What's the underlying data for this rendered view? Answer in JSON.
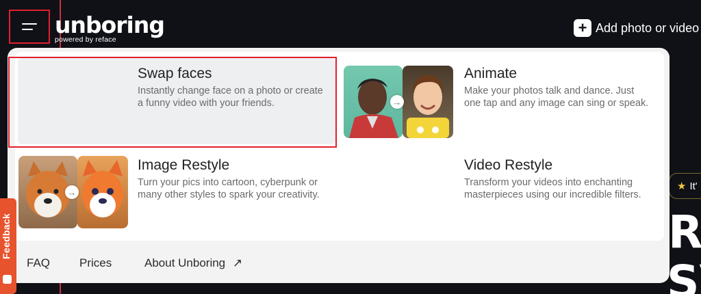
{
  "header": {
    "logo_text": "unboring",
    "logo_subtitle": "powered by reface",
    "add_button_label": "Add photo or video",
    "menu_icon": "hamburger-icon"
  },
  "menu": {
    "cards": [
      {
        "title": "Swap faces",
        "description": "Instantly change face on a photo or create a funny video with your friends.",
        "selected": true
      },
      {
        "title": "Animate",
        "description": "Make your photos talk and dance. Just one tap and any image can sing or speak."
      },
      {
        "title": "Image Restyle",
        "description": "Turn your pics into cartoon, cyberpunk or many other styles to spark your creativity."
      },
      {
        "title": "Video Restyle",
        "description": "Transform your videos into enchanting masterpieces using our incredible filters."
      }
    ],
    "footer_links": [
      {
        "label": "FAQ"
      },
      {
        "label": "Prices"
      },
      {
        "label": "About Unboring",
        "icon": "arrow-up-right-icon"
      }
    ]
  },
  "background": {
    "pill_label": "It'",
    "pill_icon": "star-icon",
    "big_text_1": "R",
    "big_text_2": "SV"
  },
  "feedback": {
    "label": "Feedback"
  },
  "colors": {
    "background": "#101117",
    "accent_red": "#e21f2c",
    "logo_dot": "#f7b531",
    "feedback": "#e6532d",
    "panel": "#f3f3f3",
    "selected_card": "#eeeff1"
  }
}
